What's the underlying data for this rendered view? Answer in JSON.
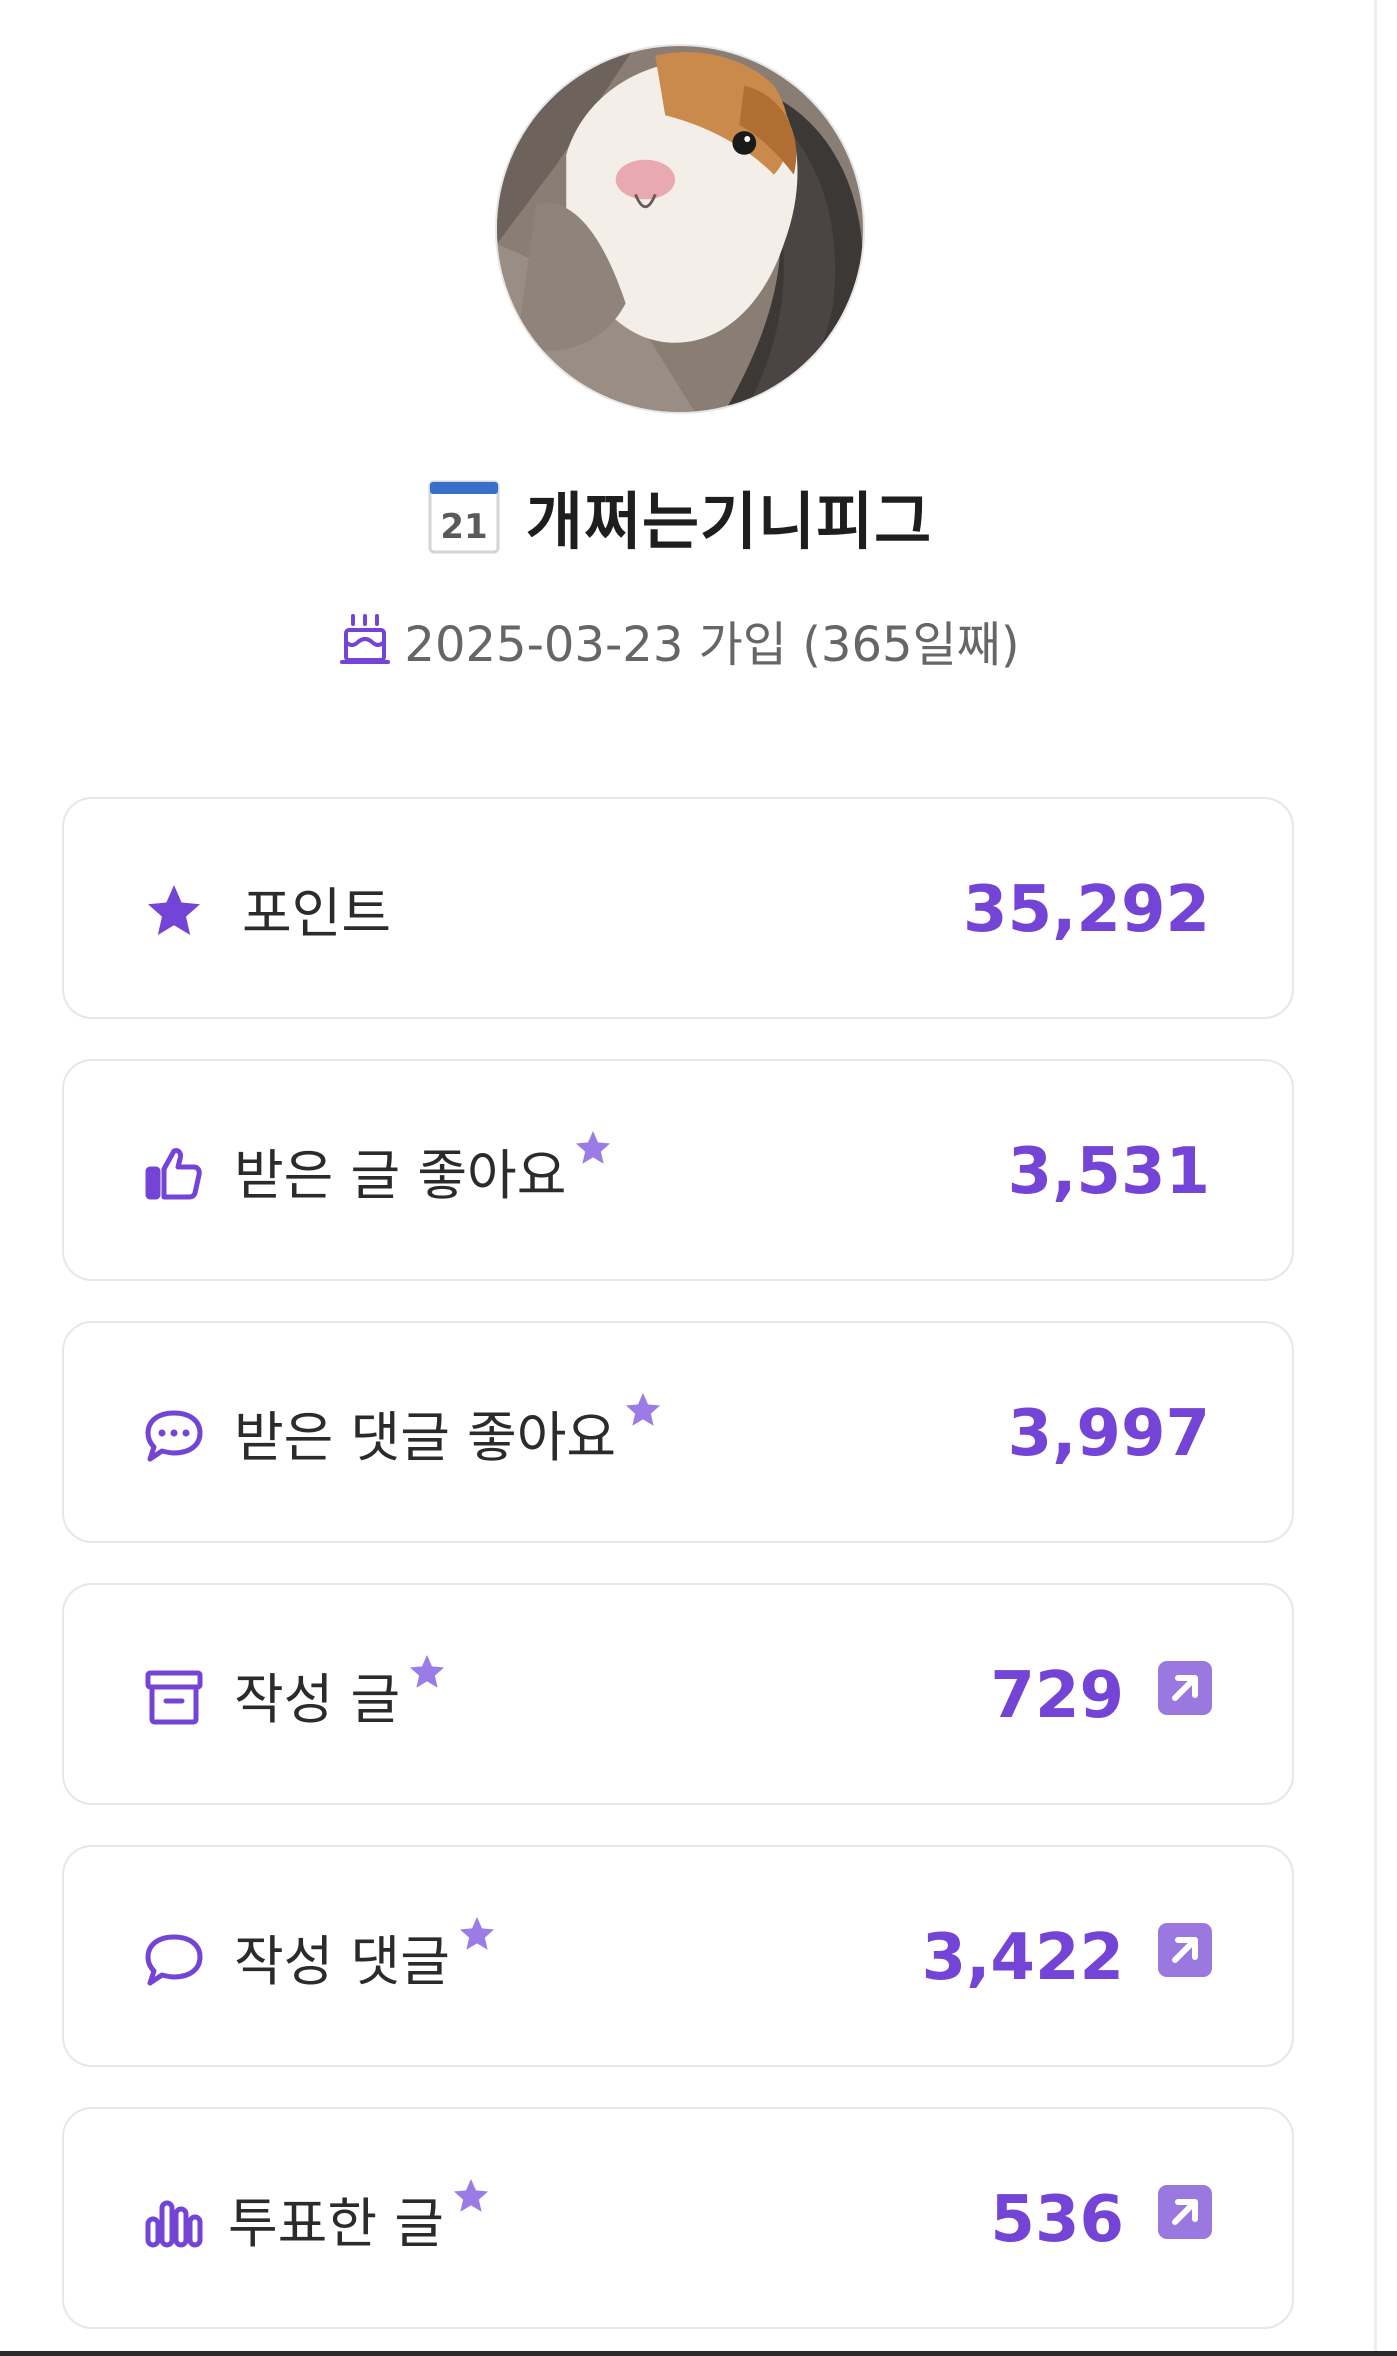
{
  "colors": {
    "accent": "#7444d6",
    "star_light": "#9b7be6",
    "card_border": "#e7e7ea",
    "muted_text": "#666666"
  },
  "profile": {
    "avatar": "guinea-pig-photo",
    "nickname": "개쩌는기니피그",
    "badge_icon": "calendar-icon",
    "badge_number": "21",
    "join_text": "2025-03-23 가입 (365일째)"
  },
  "stats": [
    {
      "icon": "star-icon",
      "label": "포인트",
      "value": "35,292",
      "starred": false,
      "link": false
    },
    {
      "icon": "thumbs-up-icon",
      "label": "받은 글 좋아요",
      "value": "3,531",
      "starred": true,
      "link": false
    },
    {
      "icon": "chat-dots-icon",
      "label": "받은 댓글 좋아요",
      "value": "3,997",
      "starred": true,
      "link": false
    },
    {
      "icon": "archive-icon",
      "label": "작성 글",
      "value": "729",
      "starred": true,
      "link": true
    },
    {
      "icon": "chat-bubble-icon",
      "label": "작성 댓글",
      "value": "3,422",
      "starred": true,
      "link": true
    },
    {
      "icon": "bar-chart-icon",
      "label": "투표한 글",
      "value": "536",
      "starred": true,
      "link": true
    }
  ]
}
